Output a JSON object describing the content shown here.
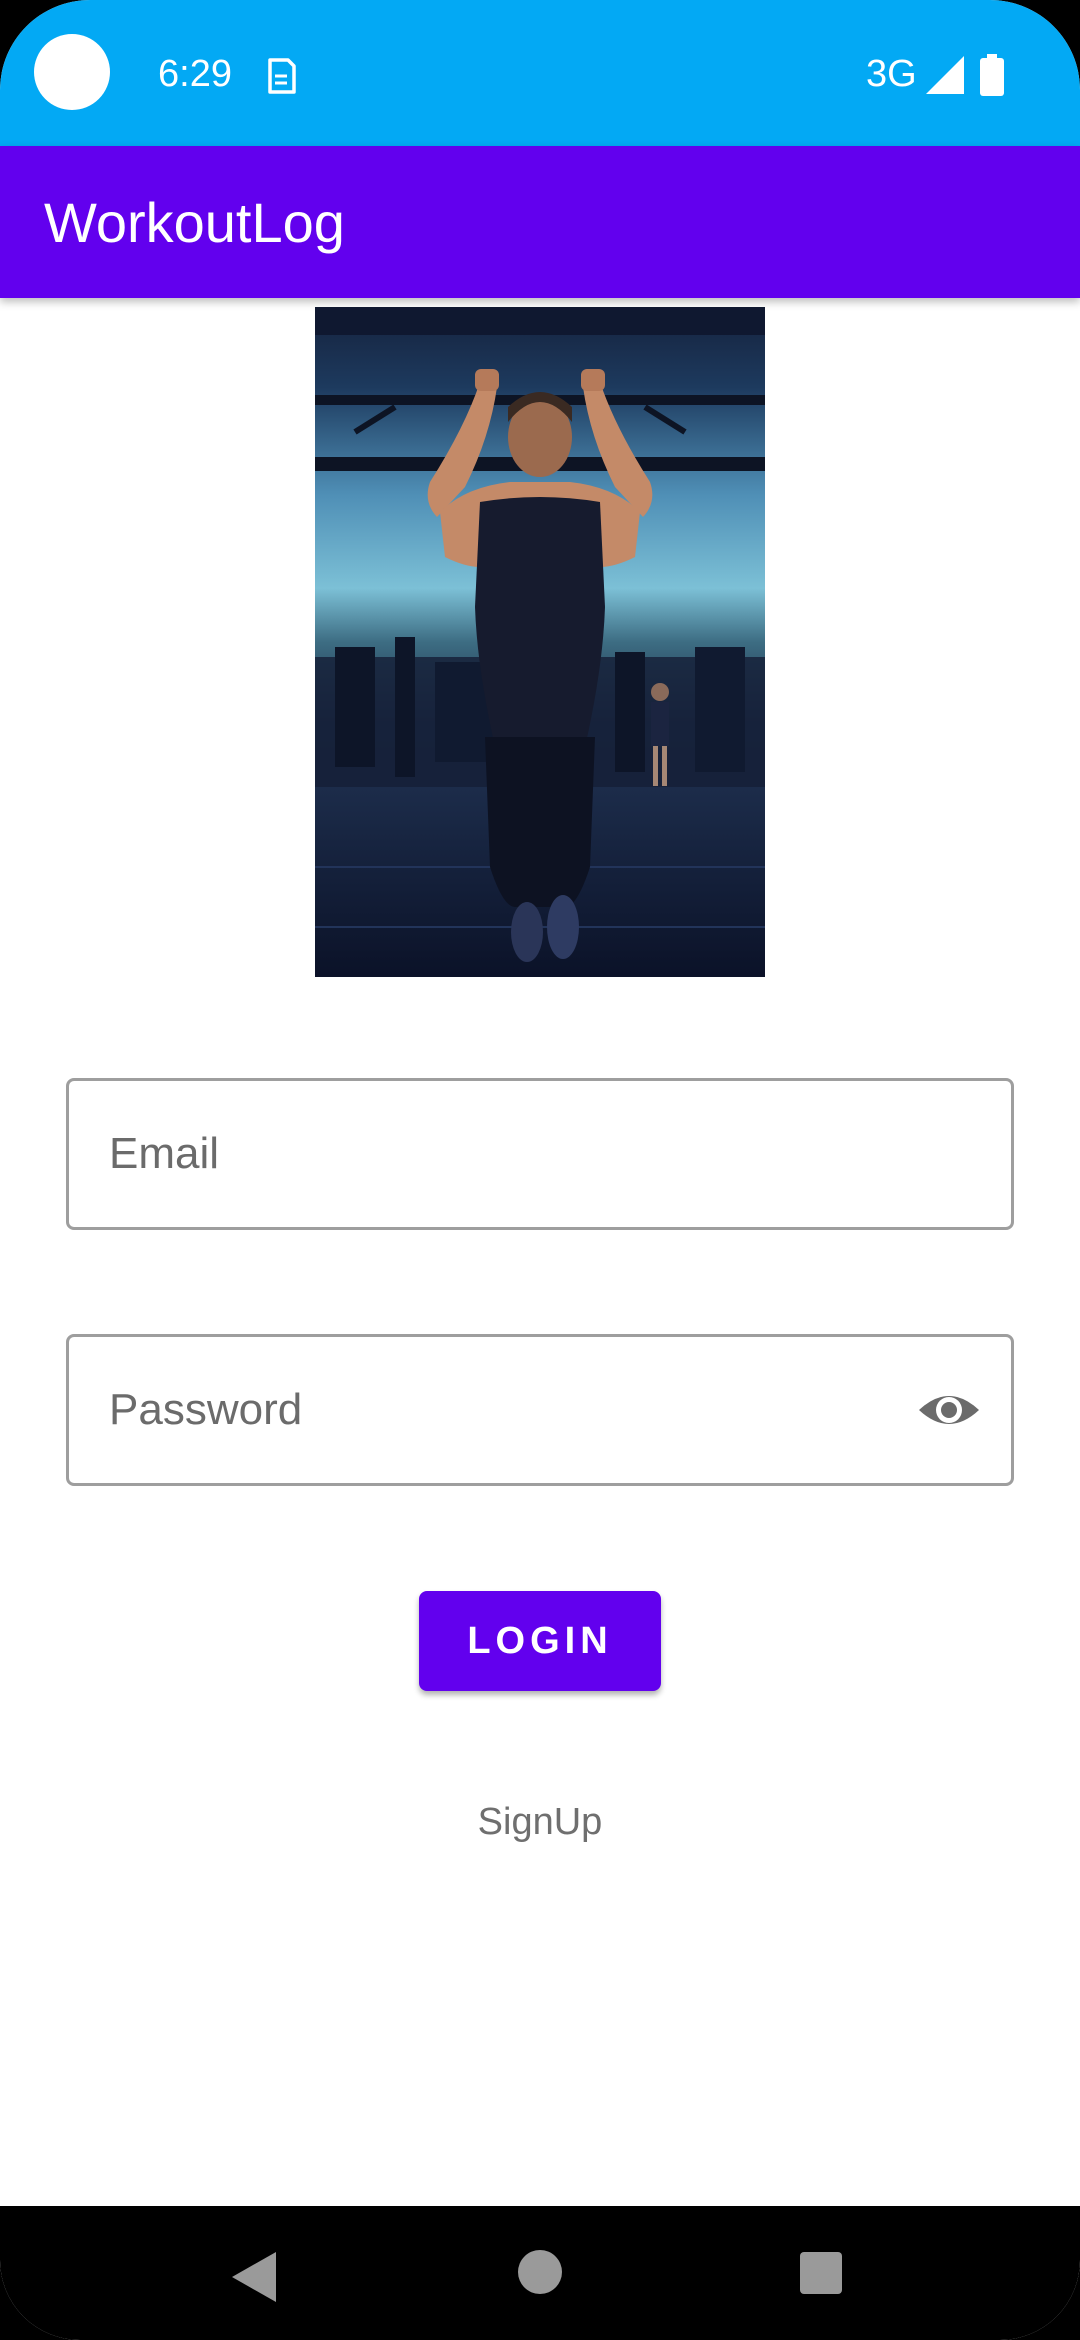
{
  "status_bar": {
    "time": "6:29",
    "network": "3G",
    "notification_icon": "sim-card-icon",
    "signal_icon": "signal-icon",
    "battery_icon": "battery-icon",
    "background_color": "#03a9f4"
  },
  "app_bar": {
    "title": "WorkoutLog",
    "background_color": "#6200ee"
  },
  "hero_image": {
    "description_icon": "gym-pullup-photo"
  },
  "form": {
    "email_placeholder": "Email",
    "email_value": "",
    "password_placeholder": "Password",
    "password_value": "",
    "password_toggle_icon": "eye-icon",
    "login_label": "LOGIN",
    "signup_label": "SignUp",
    "accent_color": "#6200ee"
  },
  "nav_bar": {
    "back_icon": "back-triangle-icon",
    "home_icon": "home-circle-icon",
    "recents_icon": "recents-square-icon"
  }
}
